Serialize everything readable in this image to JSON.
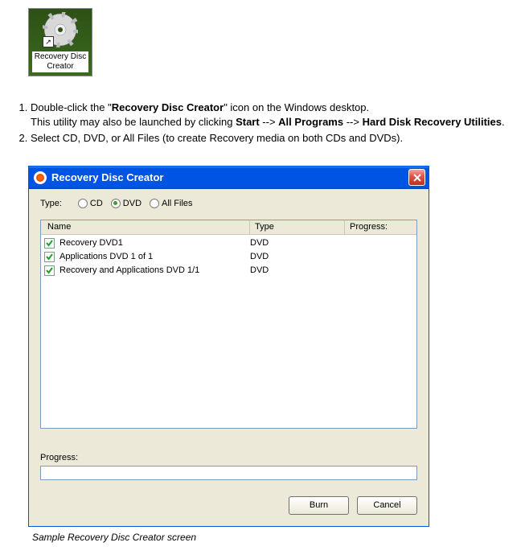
{
  "desktop": {
    "icon_label": "Recovery Disc Creator"
  },
  "instructions": {
    "step1_pre": "Double-click the \"",
    "step1_bold": "Recovery Disc Creator",
    "step1_post": "\" icon on the Windows desktop.",
    "step1_sub_pre": "This utility may also be launched by clicking ",
    "step1_sub_b1": "Start",
    "step1_sub_mid1": " --> ",
    "step1_sub_b2": "All Programs",
    "step1_sub_mid2": " --> ",
    "step1_sub_b3": "Hard Disk Recovery Utilities",
    "step1_sub_end": ".",
    "step2": "Select CD, DVD, or All Files (to create Recovery media on both CDs and DVDs)."
  },
  "window": {
    "title": "Recovery Disc Creator",
    "type_label": "Type:",
    "radios": {
      "cd": "CD",
      "dvd": "DVD",
      "all": "All Files"
    },
    "columns": {
      "name": "Name",
      "type": "Type",
      "progress": "Progress:"
    },
    "rows": [
      {
        "name": "Recovery DVD1",
        "type": "DVD"
      },
      {
        "name": "Applications DVD 1 of 1",
        "type": "DVD"
      },
      {
        "name": "Recovery and Applications DVD 1/1",
        "type": "DVD"
      }
    ],
    "progress_label": "Progress:",
    "burn_label": "Burn",
    "cancel_label": "Cancel"
  },
  "caption": "Sample Recovery Disc Creator screen"
}
